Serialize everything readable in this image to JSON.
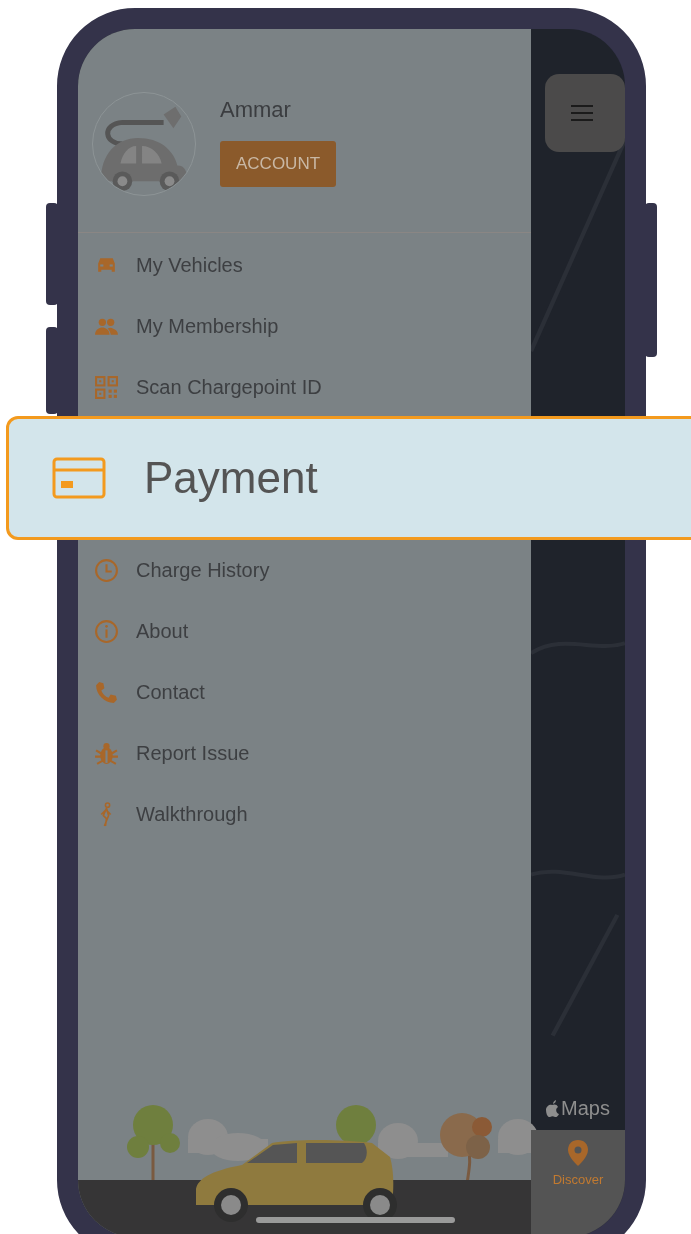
{
  "profile": {
    "name": "Ammar",
    "account_button": "ACCOUNT"
  },
  "menu_top": [
    {
      "label": "My Vehicles"
    },
    {
      "label": "My Membership"
    },
    {
      "label": "Scan Chargepoint ID"
    }
  ],
  "callout": {
    "label": "Payment"
  },
  "menu_bottom": [
    {
      "label": "Charge History"
    },
    {
      "label": "About"
    },
    {
      "label": "Contact"
    },
    {
      "label": "Report Issue"
    },
    {
      "label": "Walkthrough"
    }
  ],
  "map": {
    "attribution": "Maps"
  },
  "tab_bar": {
    "tabs": [
      {
        "label": "Discover",
        "selected": true
      }
    ]
  }
}
